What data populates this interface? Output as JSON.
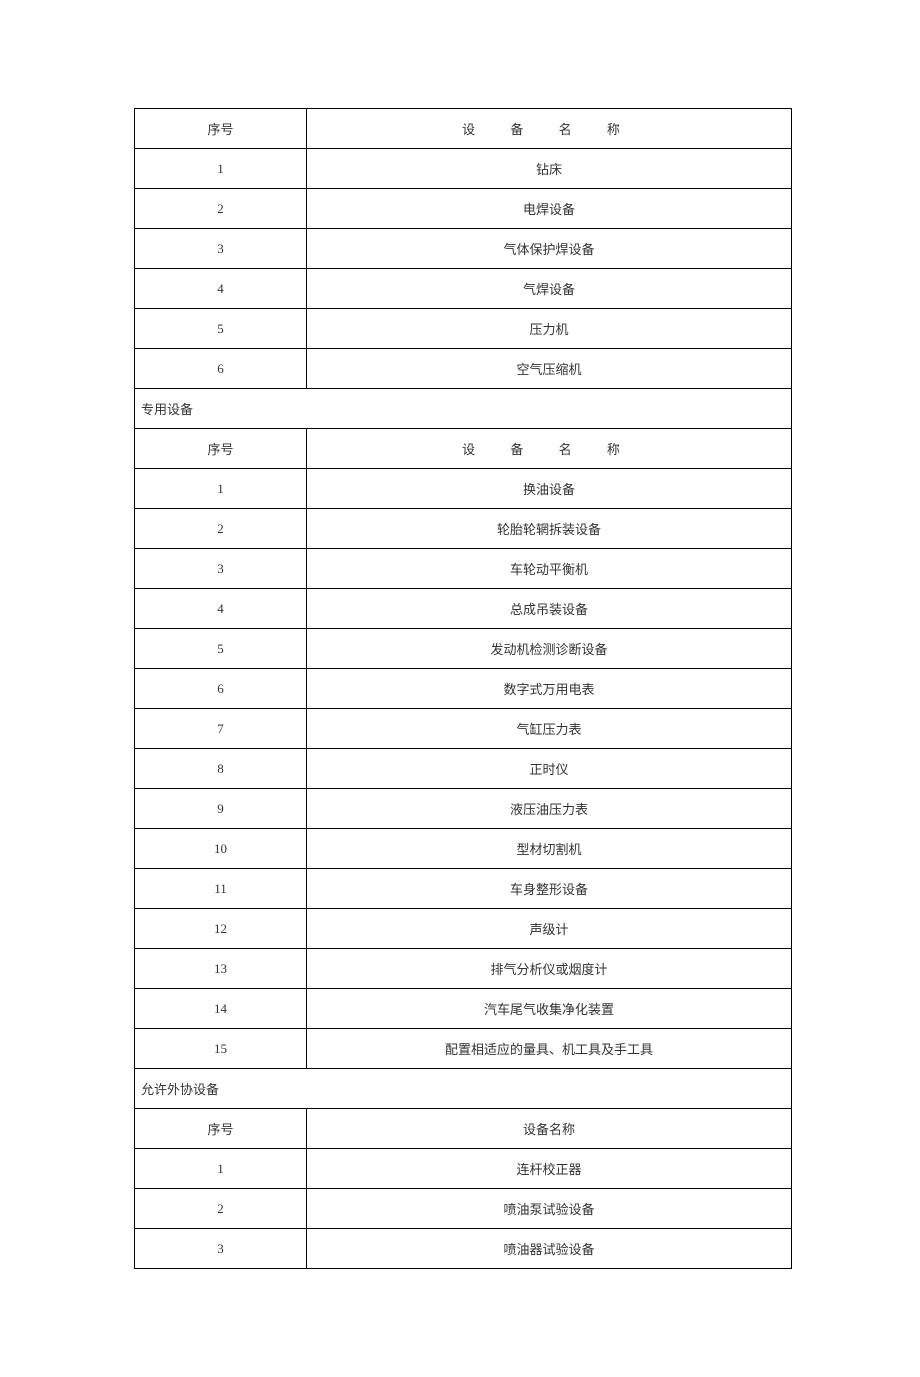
{
  "headers": {
    "idx": "序号",
    "name_spaced": "设 备 名 称",
    "name": "设备名称"
  },
  "section1": {
    "rows": [
      {
        "idx": "1",
        "name": "钻床"
      },
      {
        "idx": "2",
        "name": "电焊设备"
      },
      {
        "idx": "3",
        "name": "气体保护焊设备"
      },
      {
        "idx": "4",
        "name": "气焊设备"
      },
      {
        "idx": "5",
        "name": "压力机"
      },
      {
        "idx": "6",
        "name": "空气压缩机"
      }
    ]
  },
  "section2": {
    "title": "专用设备",
    "rows": [
      {
        "idx": "1",
        "name": "换油设备"
      },
      {
        "idx": "2",
        "name": "轮胎轮辋拆装设备"
      },
      {
        "idx": "3",
        "name": "车轮动平衡机"
      },
      {
        "idx": "4",
        "name": "总成吊装设备"
      },
      {
        "idx": "5",
        "name": "发动机检测诊断设备"
      },
      {
        "idx": "6",
        "name": "数字式万用电表"
      },
      {
        "idx": "7",
        "name": "气缸压力表"
      },
      {
        "idx": "8",
        "name": "正时仪"
      },
      {
        "idx": "9",
        "name": "液压油压力表"
      },
      {
        "idx": "10",
        "name": "型材切割机"
      },
      {
        "idx": "11",
        "name": "车身整形设备"
      },
      {
        "idx": "12",
        "name": "声级计"
      },
      {
        "idx": "13",
        "name": "排气分析仪或烟度计"
      },
      {
        "idx": "14",
        "name": "汽车尾气收集净化装置"
      },
      {
        "idx": "15",
        "name": "配置相适应的量具、机工具及手工具"
      }
    ]
  },
  "section3": {
    "title": "允许外协设备",
    "rows": [
      {
        "idx": "1",
        "name": "连杆校正器"
      },
      {
        "idx": "2",
        "name": "喷油泵试验设备"
      },
      {
        "idx": "3",
        "name": "喷油器试验设备"
      }
    ]
  }
}
